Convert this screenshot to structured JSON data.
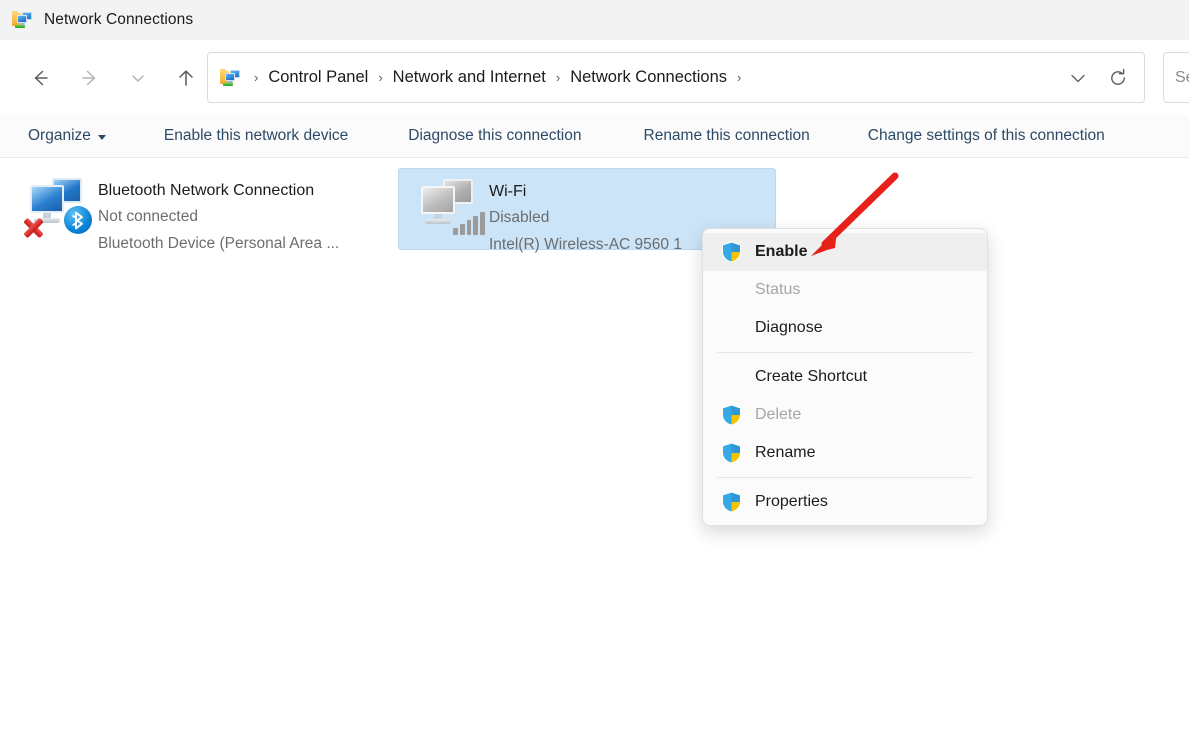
{
  "window": {
    "title": "Network Connections",
    "icon": "network-folder-icon"
  },
  "nav": {
    "back_icon": "back-arrow-icon",
    "forward_icon": "forward-arrow-icon",
    "recent_icon": "chevron-down-icon",
    "up_icon": "up-arrow-icon",
    "address_icon": "network-folder-icon",
    "dropdown_icon": "chevron-down-icon",
    "refresh_icon": "refresh-icon",
    "breadcrumbs": [
      {
        "label": "Control Panel"
      },
      {
        "label": "Network and Internet"
      },
      {
        "label": "Network Connections"
      }
    ],
    "separator": "›"
  },
  "search": {
    "value": "",
    "placeholder": "Search Network Connections"
  },
  "commandbar": {
    "organize": "Organize",
    "items": [
      {
        "label": "Enable this network device"
      },
      {
        "label": "Diagnose this connection"
      },
      {
        "label": "Rename this connection"
      },
      {
        "label": "Change settings of this connection"
      }
    ]
  },
  "connections": [
    {
      "name": "Bluetooth Network Connection",
      "status": "Not connected",
      "device": "Bluetooth Device (Personal Area ...",
      "icon": "network-adapter-bluetooth-icon",
      "selected": false,
      "disconnected": true
    },
    {
      "name": "Wi-Fi",
      "status": "Disabled",
      "device": "Intel(R) Wireless-AC 9560 1",
      "icon": "network-adapter-wifi-icon",
      "selected": true,
      "disconnected": false
    }
  ],
  "context_menu": {
    "items": [
      {
        "label": "Enable",
        "shield": true,
        "disabled": false,
        "highlighted": true
      },
      {
        "label": "Status",
        "shield": false,
        "disabled": true,
        "highlighted": false
      },
      {
        "label": "Diagnose",
        "shield": false,
        "disabled": false,
        "highlighted": false
      },
      {
        "separator": true
      },
      {
        "label": "Create Shortcut",
        "shield": false,
        "disabled": false,
        "highlighted": false
      },
      {
        "label": "Delete",
        "shield": true,
        "disabled": true,
        "highlighted": false
      },
      {
        "label": "Rename",
        "shield": true,
        "disabled": false,
        "highlighted": false
      },
      {
        "separator": true
      },
      {
        "label": "Properties",
        "shield": true,
        "disabled": false,
        "highlighted": false
      }
    ]
  },
  "annotation": {
    "arrow_color": "#e8201a",
    "points_to": "Enable"
  },
  "colors": {
    "selection_blue": "#cce4f7",
    "command_text": "#2d4a66",
    "menu_highlight": "#efefef",
    "annotation_red": "#e8201a"
  }
}
